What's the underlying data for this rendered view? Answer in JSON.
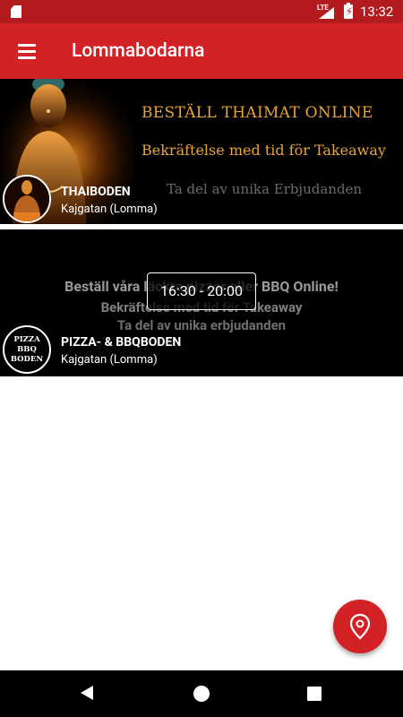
{
  "status_bar": {
    "network": "LTE",
    "time": "13:32"
  },
  "app_bar": {
    "title": "Lommabodarna",
    "menu_icon": "hamburger-menu-icon"
  },
  "restaurants": [
    {
      "name": "THAIBODEN",
      "location": "Kajgatan (Lomma)",
      "banner_lines": [
        "BESTÄLL THAIMAT ONLINE",
        "Bekräftelse med tid för Takeaway",
        "Ta del av unika Erbjudanden"
      ],
      "hours": null
    },
    {
      "name": "PIZZA- & BBQBODEN",
      "location": "Kajgatan (Lomma)",
      "banner_lines": [
        "Beställ våra läckra pizzor eller BBQ Online!",
        "Bekräftelse med tid för Takeaway",
        "Ta del av unika erbjudanden"
      ],
      "avatar_text": [
        "PIZZA",
        "BBQ",
        "BODEN"
      ],
      "hours": "16:30 - 20:00"
    }
  ],
  "fab": {
    "icon": "location-pin-icon"
  },
  "nav": {
    "back_icon": "back-triangle-icon",
    "home_icon": "home-circle-icon",
    "recent_icon": "recents-square-icon"
  },
  "colors": {
    "status_bar": "#b31b1e",
    "app_bar": "#d32226",
    "fab": "#d32226",
    "banner_gold": "#e8a33b"
  }
}
